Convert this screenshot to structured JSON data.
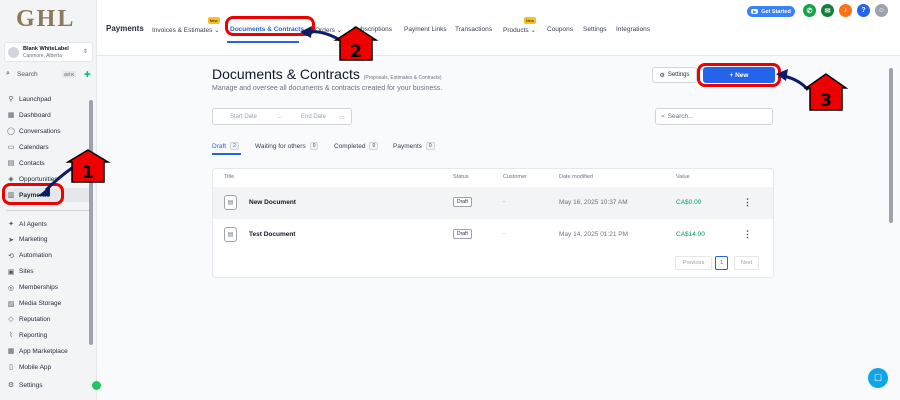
{
  "logo": "GHL",
  "account": {
    "name": "Blank WhiteLabel",
    "location": "Canmore, Alberta"
  },
  "sidebar_search": {
    "label": "Search",
    "shortcut": "ctrl K"
  },
  "sidebar": {
    "items": [
      {
        "label": "Launchpad",
        "icon": "rocket-icon"
      },
      {
        "label": "Dashboard",
        "icon": "dashboard-icon"
      },
      {
        "label": "Conversations",
        "icon": "chat-icon"
      },
      {
        "label": "Calendars",
        "icon": "calendar-icon"
      },
      {
        "label": "Contacts",
        "icon": "contacts-icon"
      },
      {
        "label": "Opportunities",
        "icon": "funnel-icon"
      },
      {
        "label": "Payments",
        "icon": "payments-icon"
      }
    ],
    "items2": [
      {
        "label": "AI Agents",
        "icon": "ai-icon"
      },
      {
        "label": "Marketing",
        "icon": "send-icon"
      },
      {
        "label": "Automation",
        "icon": "automation-icon"
      },
      {
        "label": "Sites",
        "icon": "sites-icon"
      },
      {
        "label": "Memberships",
        "icon": "memberships-icon"
      },
      {
        "label": "Media Storage",
        "icon": "media-icon"
      },
      {
        "label": "Reputation",
        "icon": "reputation-icon"
      },
      {
        "label": "Reporting",
        "icon": "reporting-icon"
      },
      {
        "label": "App Marketplace",
        "icon": "marketplace-icon"
      },
      {
        "label": "Mobile App",
        "icon": "mobile-icon"
      }
    ],
    "settings": "Settings"
  },
  "topnav": {
    "title": "Payments",
    "tabs": [
      {
        "label": "Invoices & Estimates ⌄",
        "badge": "New"
      },
      {
        "label": "Documents & Contracts",
        "badge": ""
      },
      {
        "label": "Orders ⌄",
        "badge": ""
      },
      {
        "label": "Subscriptions",
        "badge": ""
      },
      {
        "label": "Payment Links",
        "badge": ""
      },
      {
        "label": "Transactions",
        "badge": ""
      },
      {
        "label": "Products ⌄",
        "badge": "New"
      },
      {
        "label": "Coupons",
        "badge": ""
      },
      {
        "label": "Settings",
        "badge": ""
      },
      {
        "label": "Integrations",
        "badge": ""
      }
    ],
    "get_started": "Get Started",
    "help": "?"
  },
  "main": {
    "title": "Documents & Contracts",
    "title_note": "(Proposals, Estimates & Contracts)",
    "subtitle": "Manage and oversee all documents & contracts created for your business.",
    "settings_label": "Settings",
    "new_label": "+ New",
    "start_date": "Start Date",
    "end_date": "End Date",
    "search_placeholder": "Search...",
    "filter_tabs": [
      {
        "label": "Draft",
        "count": "2"
      },
      {
        "label": "Waiting for others",
        "count": "0"
      },
      {
        "label": "Completed",
        "count": "0"
      },
      {
        "label": "Payments",
        "count": "0"
      }
    ],
    "columns": [
      "Title",
      "Status",
      "Customer",
      "Date modified",
      "Value"
    ],
    "rows": [
      {
        "title": "New Document",
        "status": "Draft",
        "customer": "-",
        "date": "May 16, 2025 10:37 AM",
        "value": "CA$0.00"
      },
      {
        "title": "Test Document",
        "status": "Draft",
        "customer": "-",
        "date": "May 14, 2025 01:21 PM",
        "value": "CA$14.00"
      }
    ],
    "pagination": {
      "previous": "Previous",
      "page": "1",
      "next": "Next"
    }
  },
  "annotations": {
    "n1": "1",
    "n2": "2",
    "n3": "3"
  },
  "colors": {
    "accent": "#2563eb",
    "annotation": "#e00000",
    "value_green": "#059669"
  }
}
